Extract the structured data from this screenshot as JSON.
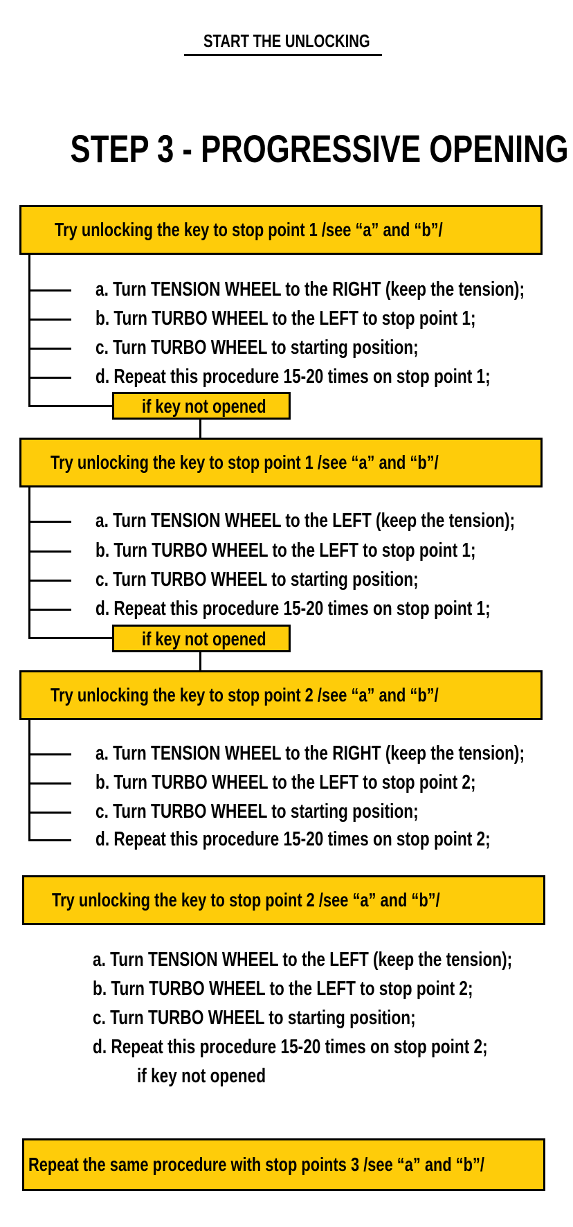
{
  "header": {
    "title": "START THE UNLOCKING",
    "step_title": "STEP 3 - PROGRESSIVE OPENING"
  },
  "accent_color": "#fecc0a",
  "blocks": [
    {
      "heading": "Try unlocking the key to stop point 1 /see “a” and “b”/",
      "steps": [
        "a. Turn TENSION WHEEL to the RIGHT (keep the tension);",
        "b. Turn TURBO WHEEL to the LEFT to stop point 1;",
        "c. Turn TURBO WHEEL to starting position;",
        "d. Repeat this procedure 15-20 times on stop point 1;"
      ],
      "connector": "if key not opened"
    },
    {
      "heading": "Try unlocking the key to stop point 1 /see “a” and “b”/",
      "steps": [
        "a. Turn TENSION WHEEL to the LEFT (keep the tension);",
        "b. Turn TURBO WHEEL to the LEFT to stop point 1;",
        "c. Turn TURBO WHEEL to starting position;",
        "d. Repeat this procedure 15-20 times on stop point 1;"
      ],
      "connector": "if key not opened"
    },
    {
      "heading": "Try unlocking the key to stop point 2 /see “a” and “b”/",
      "steps": [
        "a. Turn TENSION WHEEL to the RIGHT (keep the tension);",
        "b. Turn TURBO WHEEL to the LEFT to stop point 2;",
        "c. Turn TURBO WHEEL to starting position;",
        "d. Repeat this procedure 15-20 times on stop point 2;"
      ]
    },
    {
      "heading": "Try unlocking the key to stop point 2 /see “a” and “b”/",
      "steps": [
        "a. Turn TENSION WHEEL to the LEFT (keep the tension);",
        "b. Turn TURBO WHEEL to the LEFT to stop point 2;",
        "c. Turn TURBO WHEEL to starting position;",
        "d. Repeat this procedure 15-20 times on stop point 2;"
      ],
      "connector": "if key not opened"
    }
  ],
  "final": {
    "heading": "Repeat the same procedure with stop points 3 /see “a” and “b”/"
  }
}
